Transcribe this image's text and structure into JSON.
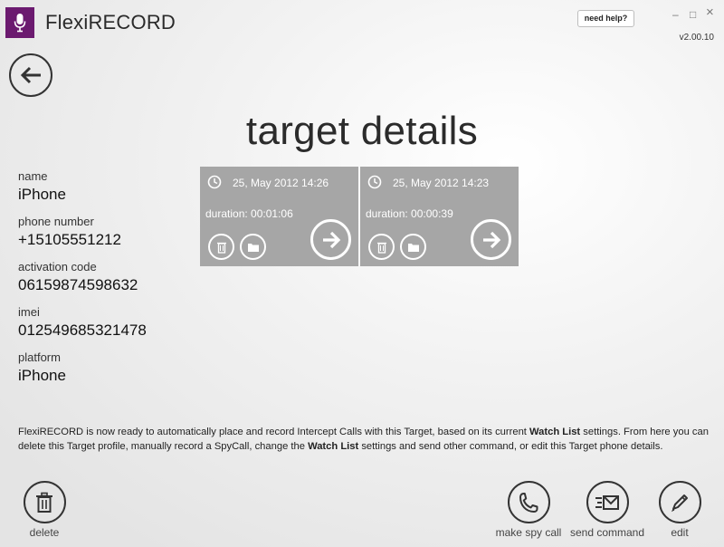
{
  "app": {
    "title_prefix": "Flexi",
    "title_suffix": "RECORD",
    "version": "v2.00.10",
    "help_label": "need help?",
    "brand_color": "#6b1a6f",
    "logo_icon": "microphone-icon"
  },
  "window_controls": {
    "minimize": "–",
    "maximize": "□",
    "close": "×"
  },
  "page_title": "target details",
  "target": [
    {
      "label": "name",
      "value": "iPhone"
    },
    {
      "label": "phone number",
      "value": "+15105551212"
    },
    {
      "label": "activation code",
      "value": "06159874598632"
    },
    {
      "label": "imei",
      "value": "012549685321478"
    },
    {
      "label": "platform",
      "value": "iPhone"
    }
  ],
  "recordings": [
    {
      "datetime": "25, May 2012 14:26",
      "duration": "duration: 00:01:06"
    },
    {
      "datetime": "25, May 2012 14:23",
      "duration": "duration: 00:00:39"
    }
  ],
  "info": {
    "part1": "FlexiRECORD is now ready to automatically place and record Intercept Calls with this Target, based on its current ",
    "bold1": "Watch List",
    "part2": " settings. From here you can delete this Target profile, manually record a SpyCall, change the ",
    "bold2": "Watch List",
    "part3": " settings and send other command, or edit this Target phone details."
  },
  "actions": {
    "delete": "delete",
    "spy_call": "make spy call",
    "send_command": "send command",
    "edit": "edit"
  }
}
